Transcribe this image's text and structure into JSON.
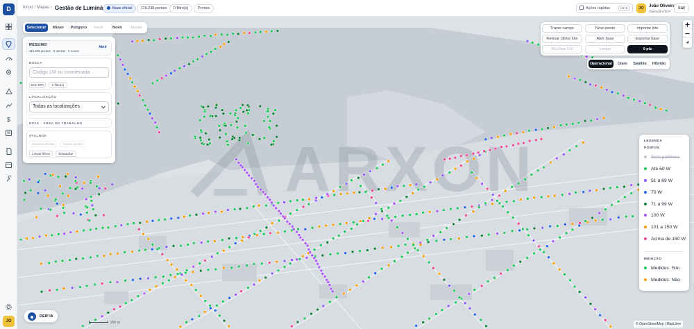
{
  "app": {
    "logo_letter": "D",
    "colors": {
      "primary": "#1d4fa3",
      "dark": "#0f141c",
      "avatar": "#efc23c",
      "water": "#c6cdd4",
      "land": "#dde2e7"
    }
  },
  "rail": {
    "icons": [
      "grid-icon",
      "map-pin-icon",
      "gauge-icon",
      "location-icon",
      "alert-triangle-icon",
      "trend-line-icon",
      "dollar-icon",
      "list-icon",
      "document-icon",
      "calendar-icon",
      "tools-icon",
      "settings-icon"
    ],
    "user_initials": "JO"
  },
  "header": {
    "breadcrumb": [
      "Início",
      "/",
      "Mapas",
      "/"
    ],
    "title": "Gestão de Luminárias",
    "base_badge": "Base oficial",
    "points_count": "116.235 pontos",
    "filters_badge": "0 filtro(s)",
    "layer_badge": "Pontos",
    "quick_actions": "Ações rápidas",
    "quick_shortcut": "Ctrl K",
    "user_name": "João Oliveira",
    "user_role": "Operação DEIP",
    "user_initials": "JO",
    "exit_label": "Sair"
  },
  "toolbar": {
    "buttons": [
      "Selecionar",
      "Mover",
      "Polígono",
      "Medir",
      "Novo",
      "Ajustar"
    ]
  },
  "side_panel": {
    "summary_title": "RESUMO",
    "summary_text": "116.235 pontos · 0 alertas · 0 novos",
    "open_label": "Abrir",
    "search_label": "BUSCA",
    "search_placeholder": "Código LM ou coordenada",
    "no_rpa": "Sem RPA",
    "filters_chip": "0 filtro(s)",
    "location_label": "LOCALIZAÇÃO",
    "location_value": "Todas as localizações",
    "rpa_label": "RPAS · ÁREA DE TRABALHO",
    "shortcuts_label": "ATALHOS",
    "shortcut_dim_1": "Somente alertas",
    "shortcut_dim_2": "Novos pontos",
    "clear_filters": "Limpar filtros",
    "fit_label": "Enquadrar"
  },
  "actions_panel": {
    "buttons": [
      "Trazer campo",
      "Novo ponto",
      "Importar lote",
      "Revisar último lote",
      "Abrir base",
      "Exportar base",
      "Atualizar lote",
      "Limpar",
      "0 pts"
    ]
  },
  "map_styles": {
    "buttons": [
      "Operacional",
      "Claro",
      "Satélite",
      "Híbrido"
    ]
  },
  "map": {
    "watermark": "ARXON"
  },
  "legend": {
    "title": "LEGENDA",
    "points_header": "PONTOS",
    "items": [
      {
        "label": "Sem potência",
        "color": "#c4c8ce"
      },
      {
        "label": "Até 50 W",
        "color": "#22c55e"
      },
      {
        "label": "51 a 69 W",
        "color": "#8b5cf6"
      },
      {
        "label": "70 W",
        "color": "#2563eb"
      },
      {
        "label": "71 a 99 W",
        "color": "#15803d"
      },
      {
        "label": "100 W",
        "color": "#a855f7"
      },
      {
        "label": "101 a 150 W",
        "color": "#f59e0b"
      },
      {
        "label": "Acima de 150 W",
        "color": "#ec4899"
      }
    ],
    "measure_header": "MEDIÇÃO",
    "measure_items": [
      {
        "label": "Medidos: Sim",
        "color": "#22c55e"
      },
      {
        "label": "Medidos: Não",
        "color": "#f59e0b"
      }
    ]
  },
  "deip": {
    "label": "DEIP IA"
  },
  "scale": {
    "label": "200 m"
  },
  "attribution": "© OpenStreetMap | MapLibre"
}
